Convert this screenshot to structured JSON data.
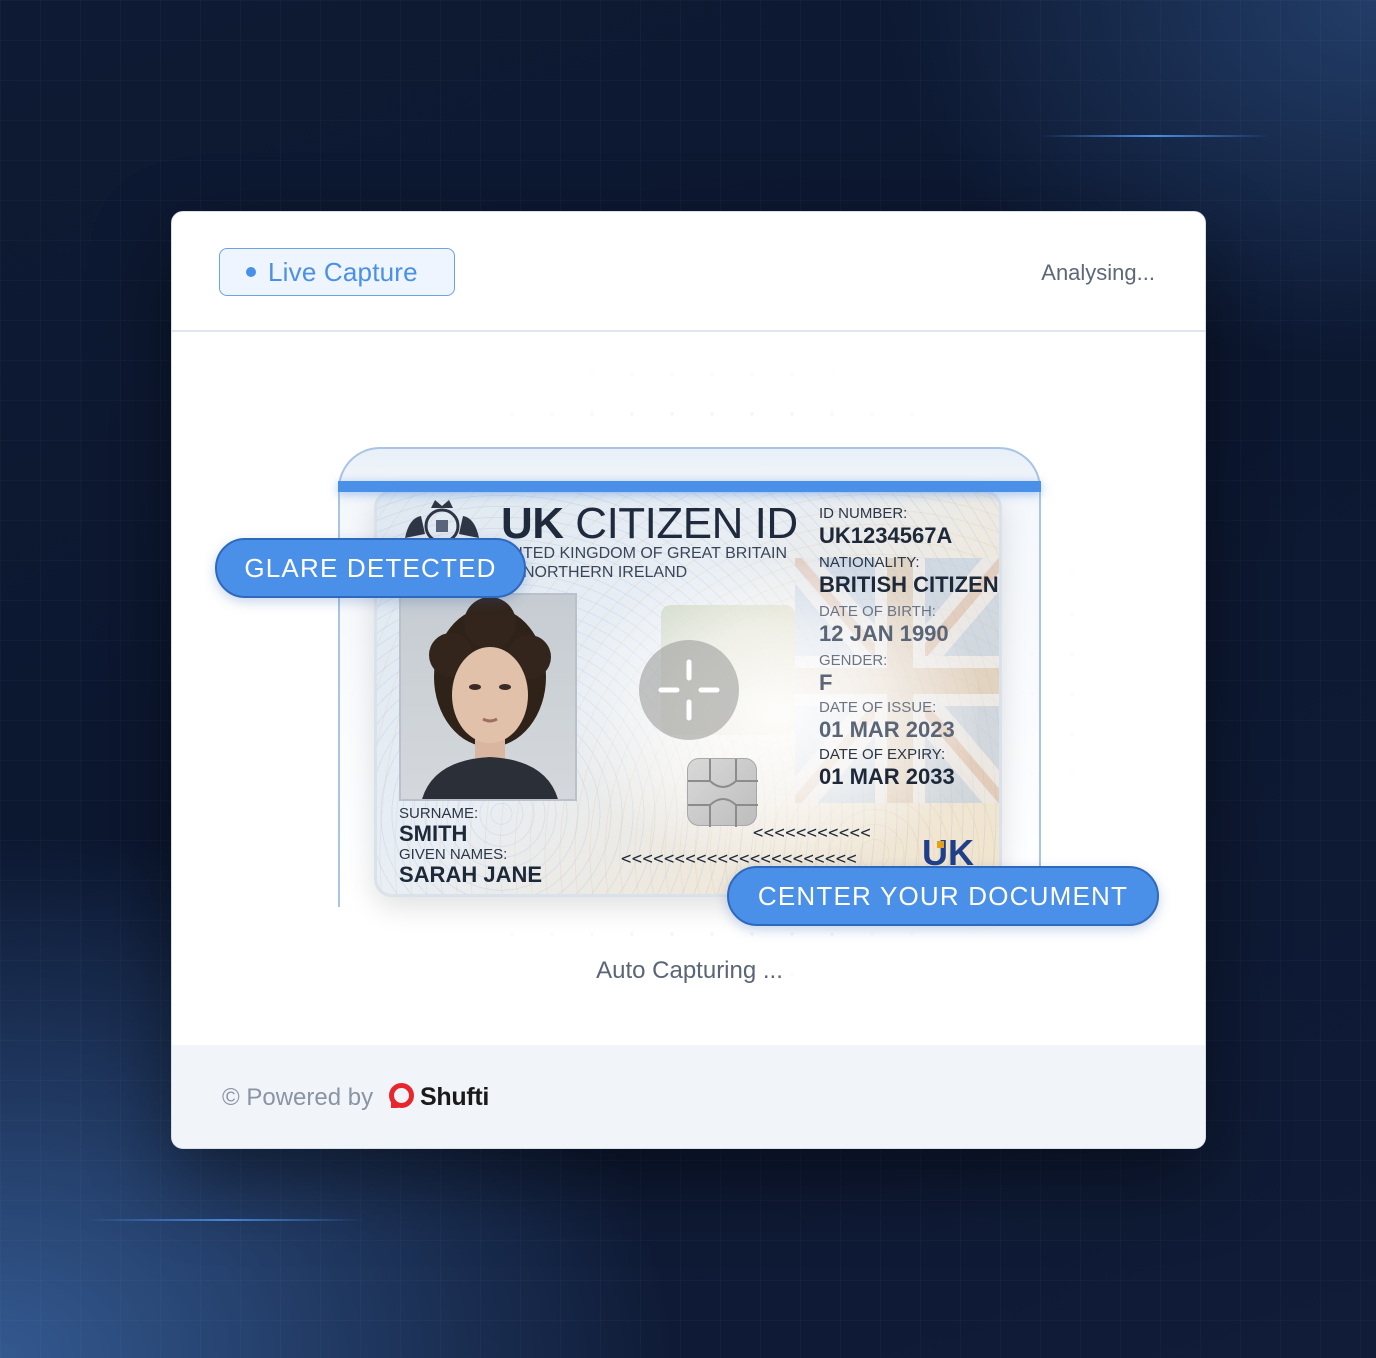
{
  "header": {
    "live_label": "Live Capture",
    "status": "Analysing..."
  },
  "card": {
    "title_bold": "UK",
    "title_rest": " CITIZEN ID",
    "subtitle_line1": "NITED KINGDOM OF GREAT BRITAIN",
    "subtitle_line2": "D NORTHERN IRELAND",
    "fields": {
      "id_number_label": "ID NUMBER:",
      "id_number": "UK1234567A",
      "nationality_label": "NATIONALITY:",
      "nationality": "BRITISH CITIZEN",
      "dob_label": "DATE OF BIRTH:",
      "dob": "12 JAN 1990",
      "gender_label": "GENDER:",
      "gender": "F",
      "issue_label": "DATE OF ISSUE:",
      "issue": "01 MAR 2023",
      "expiry_label": "DATE OF EXPIRY:",
      "expiry": "01 MAR 2033",
      "surname_label": "SURNAME:",
      "surname": "SMITH",
      "given_label": "GIVEN NAMES:",
      "given": "SARAH JANE"
    },
    "mrz_line1": "<<<<<<<<<<<",
    "mrz_line2": "<<<<<<<<<<<<<<<<<<<<<<",
    "logo_text": "UK"
  },
  "overlays": {
    "glare": "GLARE DETECTED",
    "center": "CENTER YOUR DOCUMENT"
  },
  "body": {
    "auto_capture": "Auto Capturing ..."
  },
  "footer": {
    "powered_by": "© Powered by",
    "brand": "Shufti"
  },
  "colors": {
    "accent": "#4b90e8",
    "brand_red": "#e8262d"
  },
  "icons": {
    "live": "live-dot-icon",
    "focus": "focus-crosshair-icon",
    "brand": "shufti-logo-icon"
  }
}
